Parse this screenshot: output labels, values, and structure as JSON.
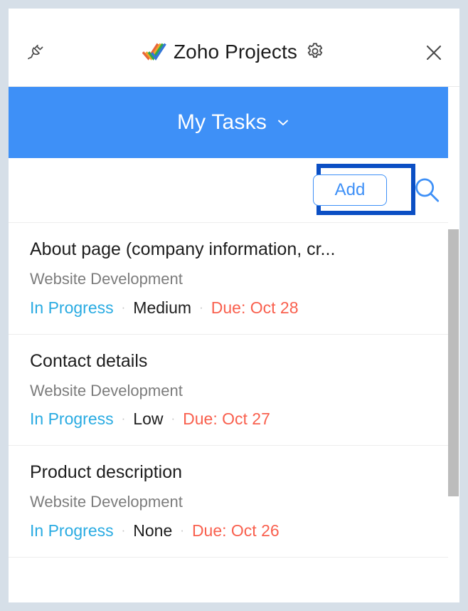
{
  "window": {
    "title": "Zoho Projects",
    "logo_icon": "zoho-projects-double-check-logo",
    "plug_icon": "plug-disconnect-icon",
    "gear_icon": "gear-icon",
    "close_icon": "close-icon",
    "background_color": "#d6dfe8"
  },
  "banner": {
    "label": "My Tasks",
    "chevron_icon": "chevron-down-icon",
    "background_color": "#3e90f7",
    "text_color": "#ffffff"
  },
  "actions": {
    "add_label": "Add",
    "add_accent_color": "#3e90f7",
    "search_icon": "search-icon",
    "highlight_color": "#0b4fc4"
  },
  "tasks": {
    "separator": "·",
    "items": [
      {
        "title": "About page (company information, cr...",
        "project": "Website Development",
        "status": "In Progress",
        "priority": "Medium",
        "due": "Due: Oct 28"
      },
      {
        "title": "Contact details",
        "project": "Website Development",
        "status": "In Progress",
        "priority": "Low",
        "due": "Due: Oct 27"
      },
      {
        "title": "Product description",
        "project": "Website Development",
        "status": "In Progress",
        "priority": "None",
        "due": "Due: Oct 26"
      }
    ]
  },
  "colors": {
    "status": "#29abe2",
    "due": "#f9604e",
    "project": "#7c7c7c",
    "title": "#1d1d1d"
  }
}
